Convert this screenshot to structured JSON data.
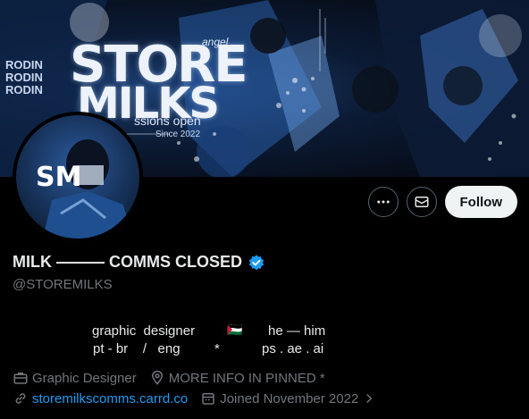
{
  "banner": {
    "word1": "STORE",
    "word2": "MILKS",
    "subtitle": "ssions open",
    "year": "Since 2022",
    "angel": "angel",
    "rodin": [
      "RODIN",
      "RODIN",
      "RODIN"
    ]
  },
  "avatar": {
    "monogram": "SM"
  },
  "actions": {
    "more_icon": "more-icon",
    "message_icon": "mail-icon",
    "follow_label": "Follow"
  },
  "profile": {
    "display_name": "MILK ——— COMMS CLOSED",
    "handle": "@STOREMILKS",
    "verified": true,
    "accent_color": "#1d9bf0"
  },
  "bio": {
    "line1_left": "graphic  designer",
    "flag": "🇵🇸",
    "line1_right": "he — him",
    "line2_left": "pt - br    /   eng",
    "line2_mid": "*",
    "line2_right": "ps . ae . ai"
  },
  "meta": {
    "category": "Graphic Designer",
    "location": "MORE  INFO  IN  PINNED  *",
    "website": "storemilkscomms.carrd.co",
    "joined": "Joined November 2022"
  }
}
